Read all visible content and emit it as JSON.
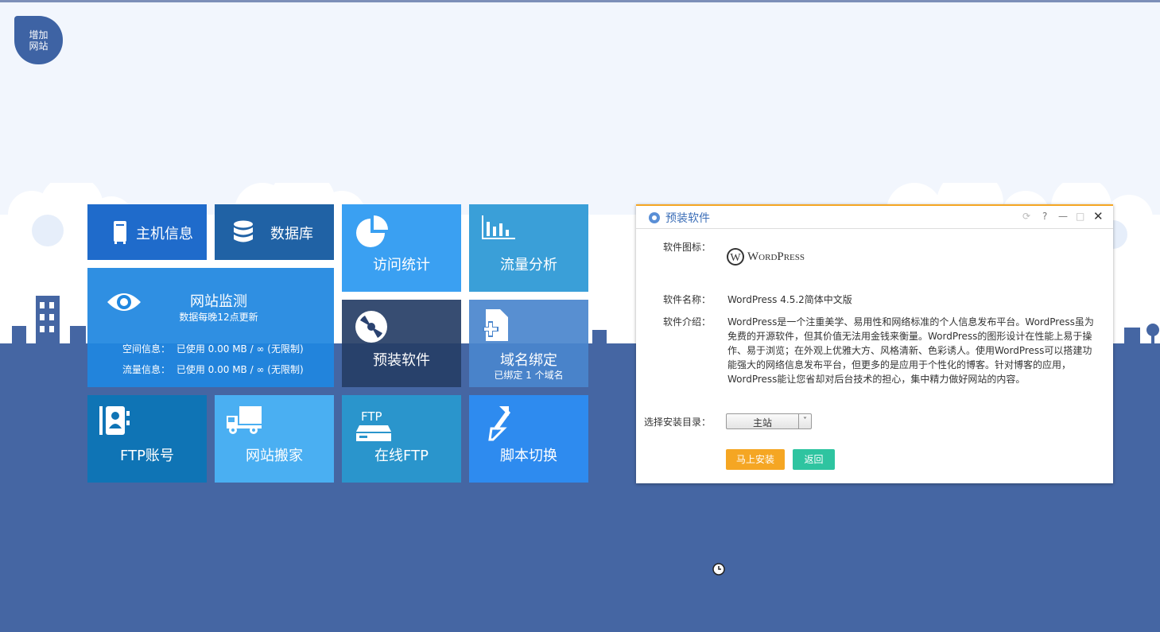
{
  "add_site": {
    "label": "增加网站"
  },
  "tiles": {
    "host_info": "主机信息",
    "database": "数据库",
    "visit_stats": "访问统计",
    "traffic_analysis": "流量分析",
    "site_monitor": {
      "title": "网站监测",
      "subtitle": "数据每晚12点更新",
      "space_label": "空间信息：",
      "space_value": "已使用 0.00 MB / ∞ (无限制)",
      "traffic_label": "流量信息：",
      "traffic_value": "已使用 0.00 MB / ∞ (无限制)"
    },
    "preinstall": "预装软件",
    "domain_bind": {
      "title": "域名绑定",
      "sub": "已绑定 1 个域名"
    },
    "ftp_account": "FTP账号",
    "site_move": "网站搬家",
    "online_ftp": {
      "title": "在线FTP",
      "icon_text": "FTP"
    },
    "script_switch": "脚本切换"
  },
  "dialog": {
    "title": "预装软件",
    "help": "?",
    "icon_label": "软件图标：",
    "logo_text": "WordPress",
    "name_label": "软件名称：",
    "name_value": "WordPress 4.5.2简体中文版",
    "intro_label": "软件介绍：",
    "intro_value": "WordPress是一个注重美学、易用性和网络标准的个人信息发布平台。WordPress虽为免费的开源软件，但其价值无法用金钱来衡量。WordPress的图形设计在性能上易于操作、易于浏览；在外观上优雅大方、风格清新、色彩诱人。使用WordPress可以搭建功能强大的网络信息发布平台，但更多的是应用于个性化的博客。针对博客的应用，WordPress能让您省却对后台技术的担心，集中精力做好网站的内容。",
    "dir_label": "选择安装目录：",
    "dir_value": "主站",
    "install_btn": "马上安装",
    "back_btn": "返回"
  },
  "colors": {
    "ground": "#4566a3",
    "sky": "#f2f6fd",
    "dialog_accent": "#f5a623",
    "install_btn": "#f5a623",
    "back_btn": "#2ec4a0"
  }
}
